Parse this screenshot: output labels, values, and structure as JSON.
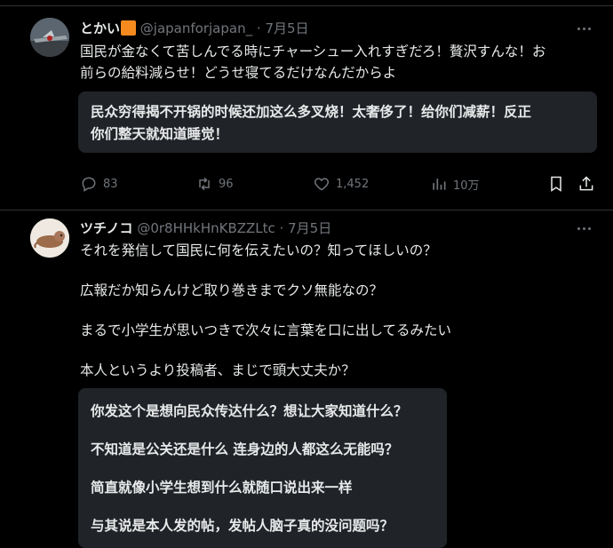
{
  "tweets": [
    {
      "display_name": "とかい",
      "handle": "@japanforjapan_",
      "separator": "·",
      "time": "7月5日",
      "text_lines": [
        "国民が金なくて苦しんでる時にチャーシュー入れすぎだろ！贅沢すんな！お",
        "前らの給料減らせ！どうせ寝てるだけなんだからよ"
      ],
      "quote_lines": [
        "民众穷得揭不开锅的时候还加这么多叉烧！太奢侈了！给你们减薪！反正",
        "你们整天就知道睡觉！"
      ],
      "actions": {
        "replies": "83",
        "retweets": "96",
        "likes": "1,452",
        "views": "10万"
      }
    },
    {
      "display_name": "ツチノコ",
      "handle": "@0r8HHkHnKBZZLtc",
      "separator": "·",
      "time": "7月5日",
      "text_lines": [
        "それを発信して国民に何を伝えたいの？知ってほしいの？",
        "広報だか知らんけど取り巻きまでクソ無能なの？",
        "まるで小学生が思いつきで次々に言葉を口に出してるみたい",
        "本人というより投稿者、まじで頭大丈夫か？"
      ],
      "quote_lines": [
        "你发这个是想向民众传达什么？想让大家知道什么？",
        "不知道是公关还是什么 连身边的人都这么无能吗？",
        "简直就像小学生想到什么就随口说出来一样",
        "与其说是本人发的帖，发帖人脑子真的没问题吗？"
      ]
    }
  ],
  "icons": {
    "more": "more-horizontal-icon",
    "reply": "reply-icon",
    "retweet": "retweet-icon",
    "like": "heart-icon",
    "views": "bar-chart-icon",
    "bookmark": "bookmark-icon",
    "share": "share-icon"
  },
  "colors": {
    "background": "#000000",
    "text": "#e7e9ea",
    "muted": "#71767b",
    "quote_bg": "#202327",
    "badge": "#f58a1f"
  }
}
